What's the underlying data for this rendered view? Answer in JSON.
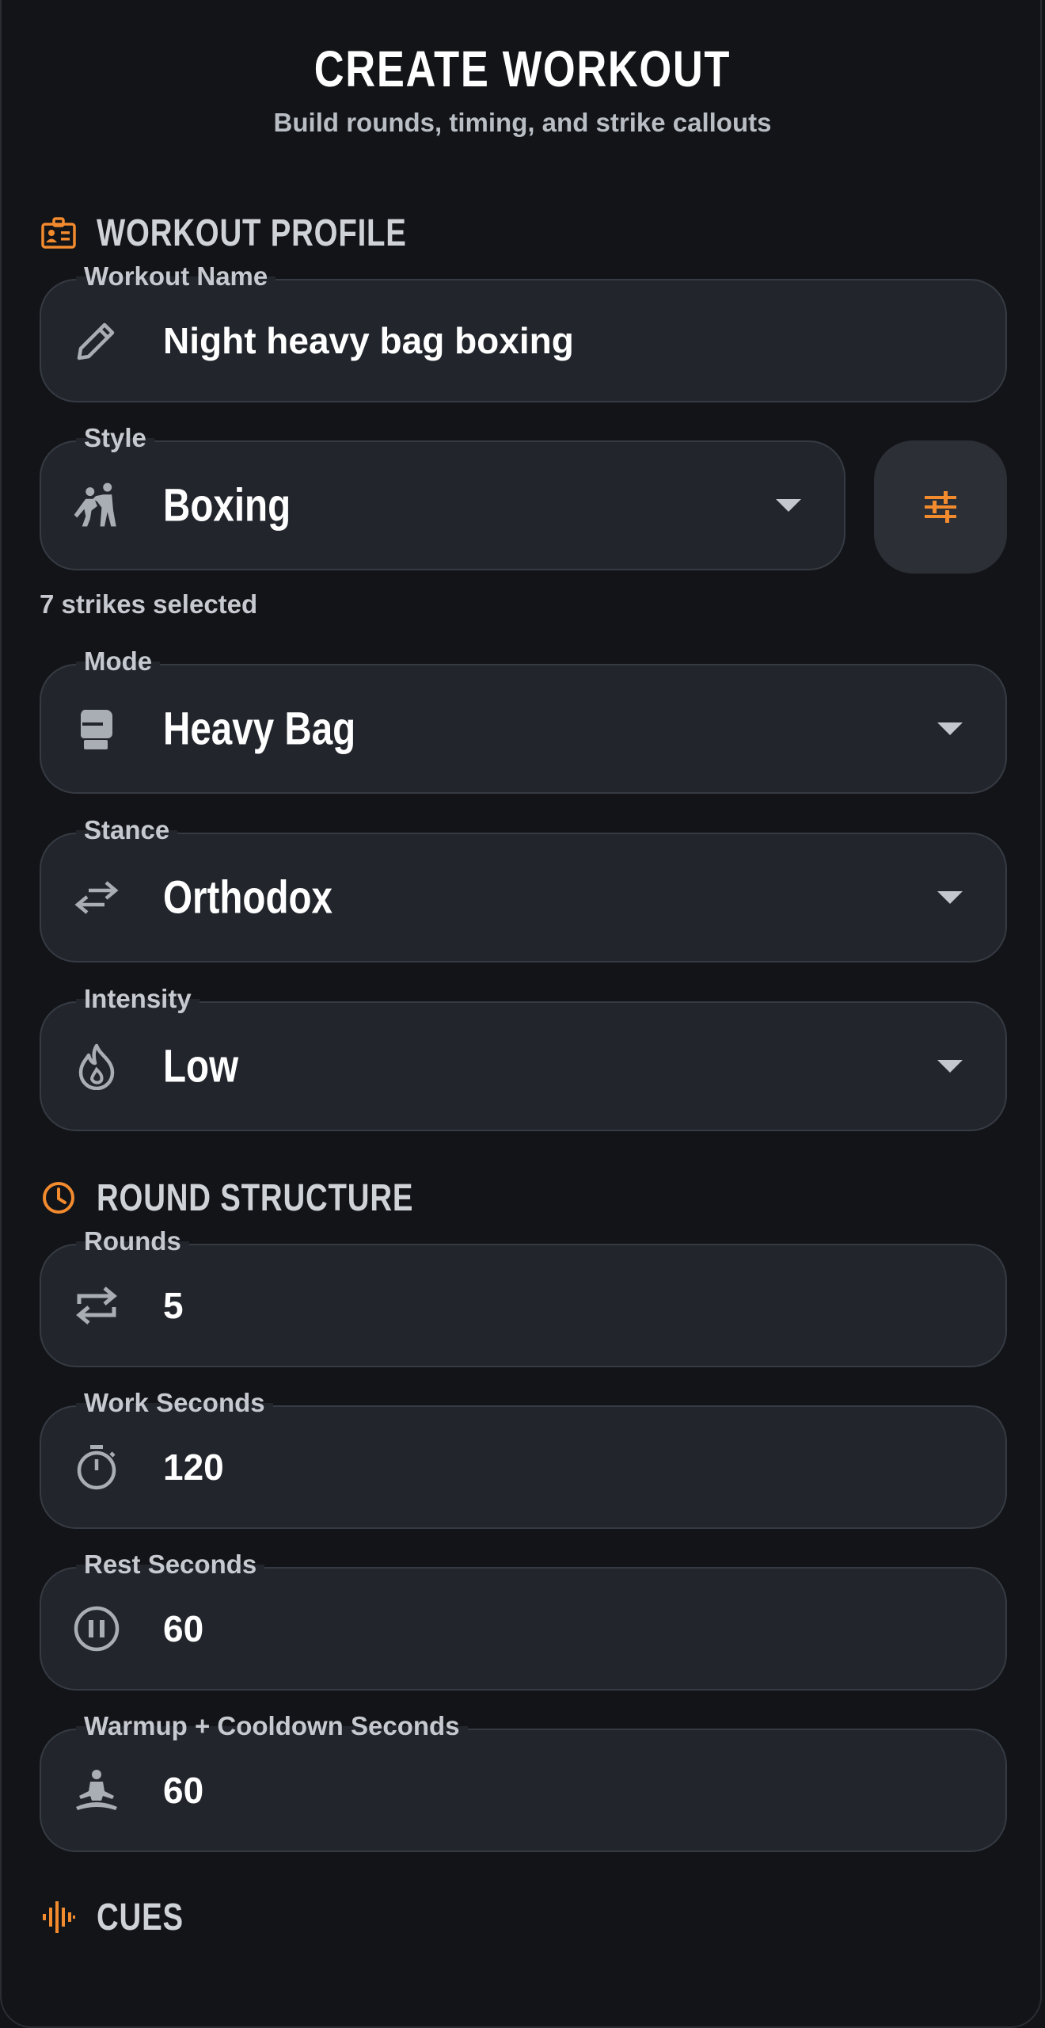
{
  "header": {
    "title": "CREATE WORKOUT",
    "subtitle": "Build rounds, timing, and strike callouts"
  },
  "sections": {
    "profile": {
      "label": "WORKOUT PROFILE",
      "icon": "id-badge-icon"
    },
    "rounds": {
      "label": "ROUND STRUCTURE",
      "icon": "clock-icon"
    },
    "cues": {
      "label": "CUES",
      "icon": "audio-wave-icon"
    }
  },
  "fields": {
    "workout_name": {
      "label": "Workout Name",
      "value": "Night heavy bag boxing",
      "icon": "pencil-icon"
    },
    "style": {
      "label": "Style",
      "value": "Boxing",
      "icon": "sparring-icon"
    },
    "style_helper": "7 strikes selected",
    "mode": {
      "label": "Mode",
      "value": "Heavy Bag",
      "icon": "boxing-glove-icon"
    },
    "stance": {
      "label": "Stance",
      "value": "Orthodox",
      "icon": "swap-arrows-icon"
    },
    "intensity": {
      "label": "Intensity",
      "value": "Low",
      "icon": "flame-icon"
    },
    "rounds": {
      "label": "Rounds",
      "value": "5",
      "icon": "repeat-icon"
    },
    "work_seconds": {
      "label": "Work Seconds",
      "value": "120",
      "icon": "stopwatch-icon"
    },
    "rest_seconds": {
      "label": "Rest Seconds",
      "value": "60",
      "icon": "pause-circle-icon"
    },
    "warmup_cooldown": {
      "label": "Warmup + Cooldown Seconds",
      "value": "60",
      "icon": "meditation-icon"
    }
  },
  "colors": {
    "accent": "#f28a2e",
    "background": "#121418",
    "field_bg": "#22262c",
    "icon_gray": "#a9adb4"
  }
}
